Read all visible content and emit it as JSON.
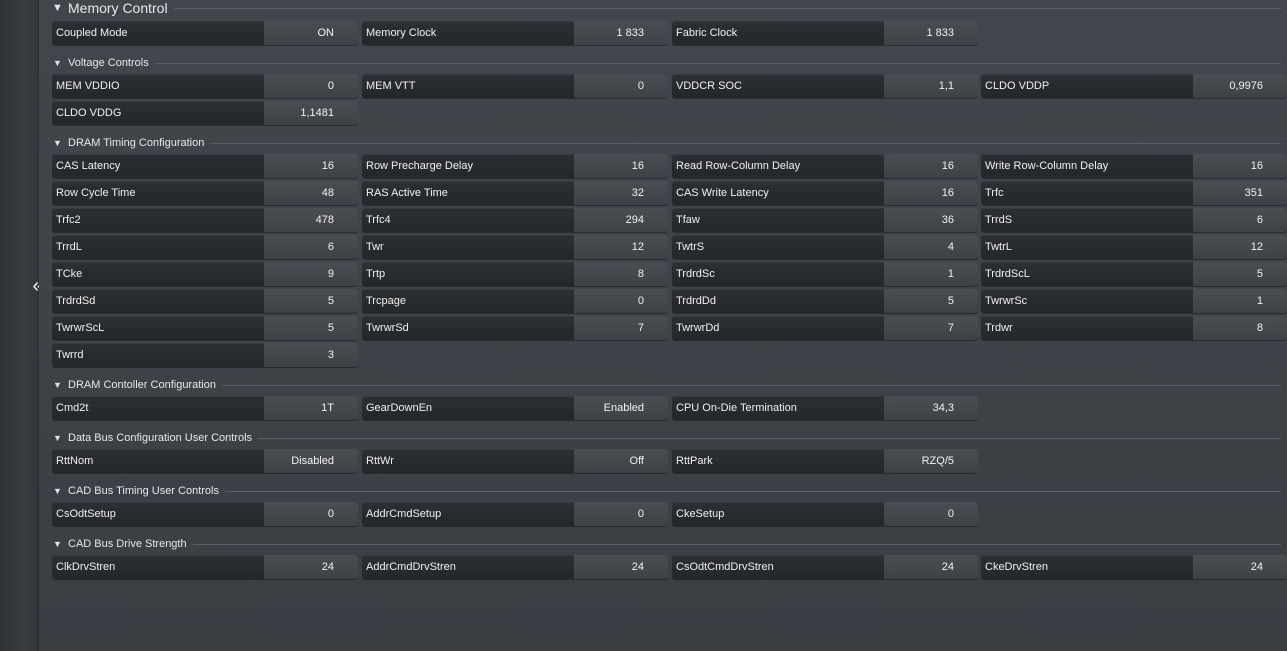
{
  "sidebar": {
    "collapse_icon": "double-chevron-left-icon",
    "collapse_glyph": "«"
  },
  "sections": [
    {
      "title": "Memory Control",
      "big": true,
      "rows": [
        [
          {
            "label": "Coupled Mode",
            "value": "ON"
          },
          {
            "label": "Memory Clock",
            "value": "1 833"
          },
          {
            "label": "Fabric Clock",
            "value": "1 833"
          }
        ]
      ]
    },
    {
      "title": "Voltage Controls",
      "rows": [
        [
          {
            "label": "MEM VDDIO",
            "value": "0"
          },
          {
            "label": "MEM VTT",
            "value": "0"
          },
          {
            "label": "VDDCR SOC",
            "value": "1,1"
          },
          {
            "label": "CLDO VDDP",
            "value": "0,9976"
          }
        ],
        [
          {
            "label": "CLDO VDDG",
            "value": "1,1481"
          }
        ]
      ]
    },
    {
      "title": "DRAM Timing Configuration",
      "rows": [
        [
          {
            "label": "CAS Latency",
            "value": "16"
          },
          {
            "label": "Row Precharge Delay",
            "value": "16"
          },
          {
            "label": "Read Row-Column Delay",
            "value": "16"
          },
          {
            "label": "Write Row-Column Delay",
            "value": "16"
          }
        ],
        [
          {
            "label": "Row Cycle Time",
            "value": "48"
          },
          {
            "label": "RAS Active Time",
            "value": "32"
          },
          {
            "label": "CAS Write Latency",
            "value": "16"
          },
          {
            "label": "Trfc",
            "value": "351"
          }
        ],
        [
          {
            "label": "Trfc2",
            "value": "478"
          },
          {
            "label": "Trfc4",
            "value": "294"
          },
          {
            "label": "Tfaw",
            "value": "36"
          },
          {
            "label": "TrrdS",
            "value": "6"
          }
        ],
        [
          {
            "label": "TrrdL",
            "value": "6"
          },
          {
            "label": "Twr",
            "value": "12"
          },
          {
            "label": "TwtrS",
            "value": "4"
          },
          {
            "label": "TwtrL",
            "value": "12"
          }
        ],
        [
          {
            "label": "TCke",
            "value": "9"
          },
          {
            "label": "Trtp",
            "value": "8"
          },
          {
            "label": "TrdrdSc",
            "value": "1"
          },
          {
            "label": "TrdrdScL",
            "value": "5"
          }
        ],
        [
          {
            "label": "TrdrdSd",
            "value": "5"
          },
          {
            "label": "Trcpage",
            "value": "0"
          },
          {
            "label": "TrdrdDd",
            "value": "5"
          },
          {
            "label": "TwrwrSc",
            "value": "1"
          }
        ],
        [
          {
            "label": "TwrwrScL",
            "value": "5"
          },
          {
            "label": "TwrwrSd",
            "value": "7"
          },
          {
            "label": "TwrwrDd",
            "value": "7"
          },
          {
            "label": "Trdwr",
            "value": "8"
          }
        ],
        [
          {
            "label": "Twrrd",
            "value": "3"
          }
        ]
      ]
    },
    {
      "title": "DRAM Contoller Configuration",
      "rows": [
        [
          {
            "label": "Cmd2t",
            "value": "1T"
          },
          {
            "label": "GearDownEn",
            "value": "Enabled"
          },
          {
            "label": "CPU On-Die Termination",
            "value": "34,3"
          }
        ]
      ]
    },
    {
      "title": "Data Bus Configuration User Controls",
      "rows": [
        [
          {
            "label": "RttNom",
            "value": "Disabled"
          },
          {
            "label": "RttWr",
            "value": "Off"
          },
          {
            "label": "RttPark",
            "value": "RZQ/5"
          }
        ]
      ]
    },
    {
      "title": "CAD Bus Timing User Controls",
      "rows": [
        [
          {
            "label": "CsOdtSetup",
            "value": "0"
          },
          {
            "label": "AddrCmdSetup",
            "value": "0"
          },
          {
            "label": "CkeSetup",
            "value": "0"
          }
        ]
      ]
    },
    {
      "title": "CAD Bus Drive Strength",
      "rows": [
        [
          {
            "label": "ClkDrvStren",
            "value": "24"
          },
          {
            "label": "AddrCmdDrvStren",
            "value": "24"
          },
          {
            "label": "CsOdtCmdDrvStren",
            "value": "24"
          },
          {
            "label": "CkeDrvStren",
            "value": "24"
          }
        ]
      ]
    }
  ]
}
